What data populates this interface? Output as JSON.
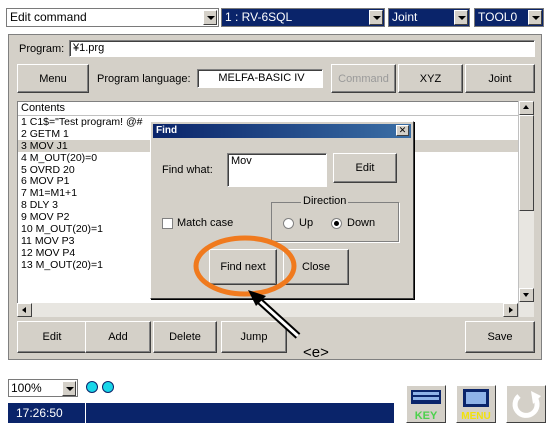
{
  "top_bar": {
    "command_title": "Edit command",
    "robot_select": "1 : RV-6SQL",
    "coord_select": "Joint",
    "tool_select": "TOOL0"
  },
  "program_row": {
    "program_label": "Program:",
    "program_value": "¥1.prg"
  },
  "toolbar": {
    "menu_label": "Menu",
    "language_label": "Program language:",
    "language_value": "MELFA-BASIC IV",
    "command_label": "Command",
    "xyz_label": "XYZ",
    "joint_label": "Joint"
  },
  "contents": {
    "header": "Contents",
    "lines": [
      "1 C1$=\"Test program! @#",
      "2 GETM 1",
      "3 MOV J1",
      "4 M_OUT(20)=0",
      "5 OVRD 20",
      "6 MOV P1",
      "7 M1=M1+1",
      "8 DLY 3",
      "9 MOV P2",
      "10 M_OUT(20)=1",
      "11 MOV P3",
      "12 MOV P4",
      "13 M_OUT(20)=1"
    ],
    "selected_line_index": 2
  },
  "find_dialog": {
    "title": "Find",
    "find_what_label": "Find what:",
    "find_what_value": "Mov",
    "edit_label": "Edit",
    "direction_label": "Direction",
    "match_case_label": "Match case",
    "up_label": "Up",
    "down_label": "Down",
    "direction_selected": "Down",
    "find_next_label": "Find next",
    "close_label": "Close"
  },
  "bottom_buttons": {
    "edit_label": "Edit",
    "add_label": "Add",
    "delete_label": "Delete",
    "jump_label": "Jump",
    "save_label": "Save"
  },
  "footer": {
    "zoom_value": "100%",
    "time": "17:26:50",
    "key_icon_text": "KEY",
    "menu_icon_text": "MENU"
  },
  "annotation": {
    "label": "<e>",
    "highlight_color": "#f07a1e"
  }
}
